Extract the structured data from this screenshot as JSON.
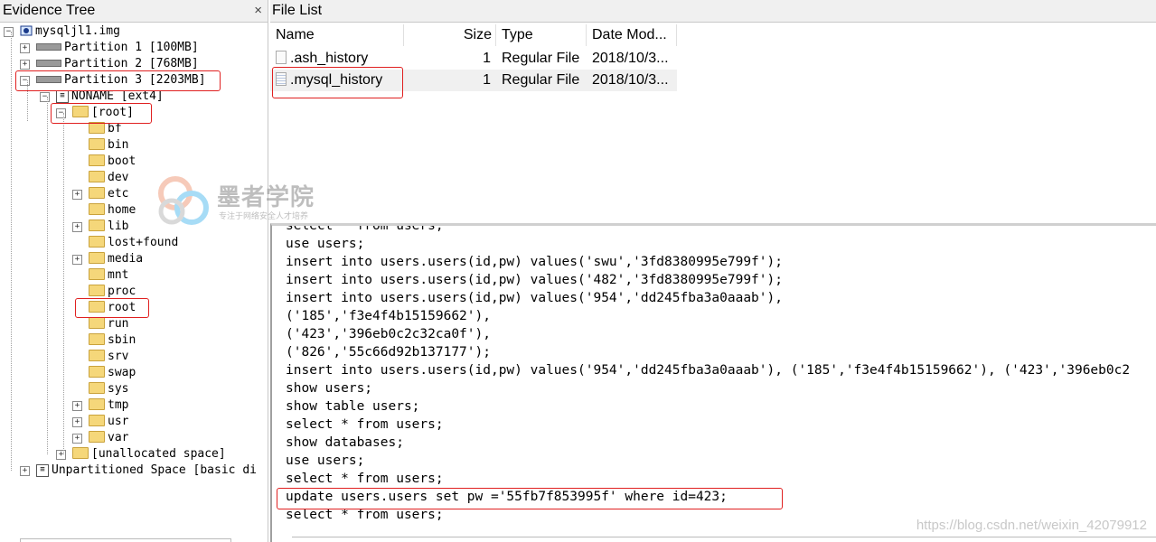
{
  "evidence_tree": {
    "title": "Evidence Tree",
    "close_glyph": "×",
    "image_name": "mysqljl1.img",
    "partitions": [
      {
        "label": "Partition 1 [100MB]"
      },
      {
        "label": "Partition 2 [768MB]"
      },
      {
        "label": "Partition 3 [2203MB]"
      }
    ],
    "filesystem": "NONAME [ext4]",
    "root_folder": "[root]",
    "folders": [
      "bf",
      "bin",
      "boot",
      "dev",
      "etc",
      "home",
      "lib",
      "lost+found",
      "media",
      "mnt",
      "proc",
      "root",
      "run",
      "sbin",
      "srv",
      "swap",
      "sys",
      "tmp",
      "usr",
      "var"
    ],
    "unallocated": "[unallocated space]",
    "unpartitioned": "Unpartitioned Space [basic di"
  },
  "file_list": {
    "title": "File List",
    "columns": {
      "name": "Name",
      "size": "Size",
      "type": "Type",
      "date": "Date Mod..."
    },
    "rows": [
      {
        "name": ".ash_history",
        "size": "1",
        "type": "Regular File",
        "date": "2018/10/3..."
      },
      {
        "name": ".mysql_history",
        "size": "1",
        "type": "Regular File",
        "date": "2018/10/3..."
      }
    ]
  },
  "viewer": {
    "lines": [
      "select * from users;",
      "use users;",
      "insert into users.users(id,pw) values('swu','3fd8380995e799f');",
      "insert into users.users(id,pw) values('482','3fd8380995e799f');",
      "insert into users.users(id,pw) values('954','dd245fba3a0aaab'),",
      "('185','f3e4f4b15159662'),",
      "('423','396eb0c2c32ca0f'),",
      "('826','55c66d92b137177');",
      "insert into users.users(id,pw) values('954','dd245fba3a0aaab'), ('185','f3e4f4b15159662'), ('423','396eb0c2",
      "show users;",
      "show table users;",
      "select * from users;",
      "show databases;",
      "use users;",
      "select * from users;",
      "update users.users set pw ='55fb7f853995f' where id=423;",
      "select * from users;"
    ]
  },
  "watermark": {
    "title": "墨者学院",
    "subtitle": "专注于网络安全人才培养"
  },
  "credit": "https://blog.csdn.net/weixin_42079912",
  "colors": {
    "highlight_box": "#e02020",
    "folder": "#f5d77a"
  }
}
